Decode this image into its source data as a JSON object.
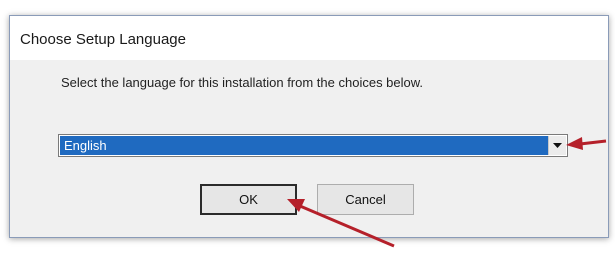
{
  "dialog": {
    "title": "Choose Setup Language",
    "prompt": "Select the language for this installation from the choices below.",
    "language_select": {
      "selected": "English"
    },
    "buttons": {
      "ok_label": "OK",
      "cancel_label": "Cancel"
    }
  },
  "icons": {
    "dropdown": "chevron-down-icon",
    "annotation": "arrow-icon"
  },
  "colors": {
    "selection": "#1f6ac0",
    "annotation_arrow": "#b5202a"
  }
}
